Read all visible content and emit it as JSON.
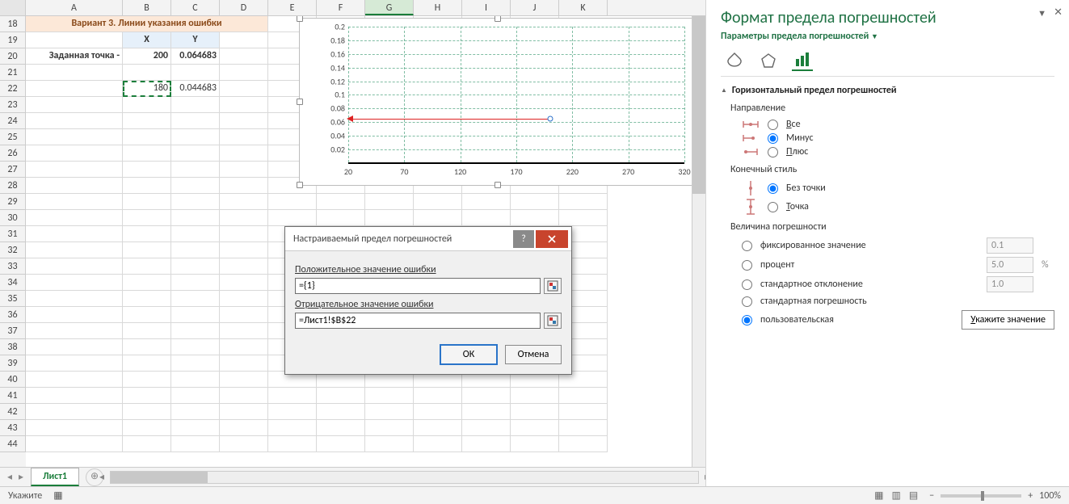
{
  "columns": [
    "A",
    "B",
    "C",
    "D",
    "E",
    "F",
    "G",
    "H",
    "I",
    "J",
    "K"
  ],
  "selected_col": "G",
  "row_start": 18,
  "row_end": 44,
  "sheet": {
    "title": "Вариант 3. Линии указания ошибки",
    "hdr_X": "X",
    "hdr_Y": "Y",
    "label20": "Заданная точка -",
    "B20": "200",
    "C20": "0.064683",
    "B22": "180",
    "C22": "0.044683"
  },
  "chart_data": {
    "type": "scatter",
    "x": [
      200
    ],
    "y": [
      0.064683
    ],
    "xlim": [
      20,
      320
    ],
    "ylim": [
      0.02,
      0.2
    ],
    "x_ticks": [
      20,
      70,
      120,
      170,
      220,
      270,
      320
    ],
    "y_ticks": [
      0.02,
      0.04,
      0.06,
      0.08,
      0.1,
      0.12,
      0.14,
      0.16,
      0.18,
      0.2
    ],
    "error_bar": {
      "direction": "minus",
      "value": 180
    }
  },
  "dialog": {
    "title": "Настраиваемый предел погрешностей",
    "pos_label": "Положительное значение ошибки",
    "pos_value": "={1}",
    "neg_label": "Отрицательное значение ошибки",
    "neg_value": "=Лист1!$B$22",
    "ok": "ОК",
    "cancel": "Отмена"
  },
  "panel": {
    "title": "Формат предела погрешностей",
    "subtitle": "Параметры предела погрешностей",
    "section": "Горизонтальный предел погрешностей",
    "dir_label": "Направление",
    "dir_all": "Все",
    "dir_minus": "Минус",
    "dir_plus": "Плюс",
    "end_label": "Конечный стиль",
    "end_nocap": "Без точки",
    "end_cap": "Точка",
    "amt_label": "Величина погрешности",
    "amt_fixed": "фиксированное значение",
    "amt_fixed_val": "0.1",
    "amt_pct": "процент",
    "amt_pct_val": "5.0",
    "amt_pct_sym": "%",
    "amt_stddev": "стандартное отклонение",
    "amt_stddev_val": "1.0",
    "amt_stderr": "стандартная погрешность",
    "amt_custom": "пользовательская",
    "custom_btn": "Укажите значение"
  },
  "tabs": {
    "sheet1": "Лист1"
  },
  "status": {
    "mode": "Укажите",
    "zoom": "100%"
  }
}
